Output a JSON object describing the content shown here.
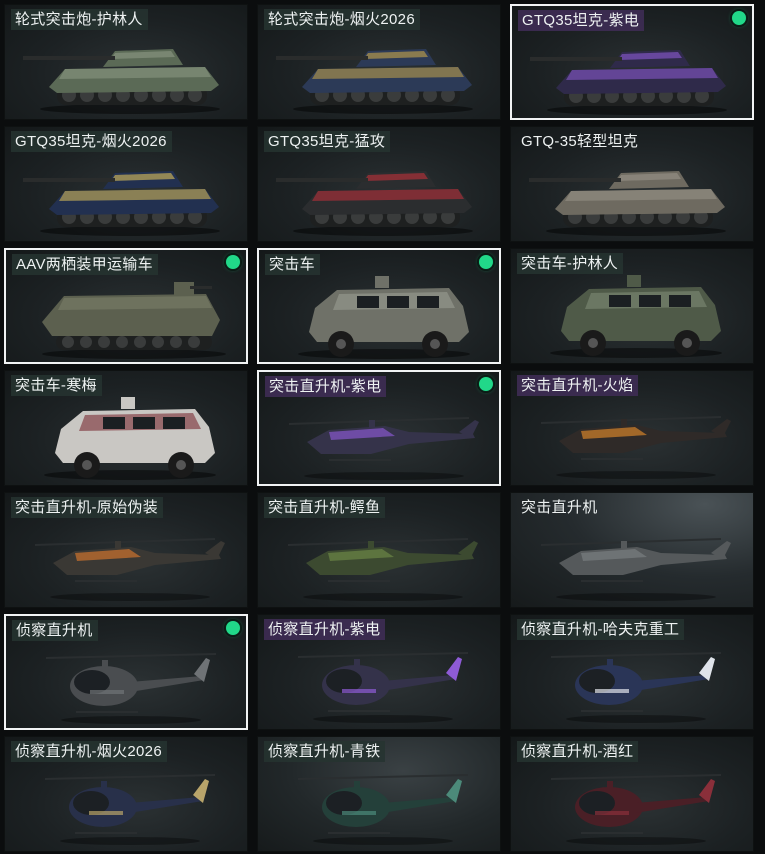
{
  "vehicles": [
    {
      "name": "轮式突击炮-护林人",
      "type": "tank",
      "body": "#5b6a56",
      "accent": "#8e9a86",
      "equipped": false
    },
    {
      "name": "轮式突击炮-烟火2026",
      "type": "tank",
      "body": "#2c3a57",
      "accent": "#c9a64a",
      "equipped": false
    },
    {
      "name": "GTQ35坦克-紫电",
      "type": "tank",
      "body": "#2f2a4a",
      "accent": "#8e5bd6",
      "equipped": true
    },
    {
      "name": "GTQ35坦克-烟火2026",
      "type": "tank",
      "body": "#223050",
      "accent": "#e0c25a",
      "equipped": false
    },
    {
      "name": "GTQ35坦克-猛攻",
      "type": "tank",
      "body": "#2b2d2f",
      "accent": "#c2303a",
      "equipped": false
    },
    {
      "name": "GTQ-35轻型坦克",
      "type": "tank",
      "body": "#6e6a60",
      "accent": "#9a958a",
      "equipped": false
    },
    {
      "name": "AAV两栖装甲运输车",
      "type": "apc",
      "body": "#5c604f",
      "accent": "#7d826c",
      "equipped": true
    },
    {
      "name": "突击车",
      "type": "car",
      "body": "#6f7168",
      "accent": "#9a9c92",
      "equipped": true
    },
    {
      "name": "突击车-护林人",
      "type": "car",
      "body": "#4f5a48",
      "accent": "#7f8a76",
      "equipped": false
    },
    {
      "name": "突击车-寒梅",
      "type": "car",
      "body": "#c9c7c3",
      "accent": "#7a2b33",
      "equipped": false
    },
    {
      "name": "突击直升机-紫电",
      "type": "heli",
      "body": "#35334a",
      "accent": "#8e5bd6",
      "equipped": true
    },
    {
      "name": "突击直升机-火焰",
      "type": "heli",
      "body": "#2f2a28",
      "accent": "#e08a2a",
      "equipped": false
    },
    {
      "name": "突击直升机-原始伪装",
      "type": "heli",
      "body": "#3a3834",
      "accent": "#d8782c",
      "equipped": false
    },
    {
      "name": "突击直升机-鳄鱼",
      "type": "heli",
      "body": "#3c4a30",
      "accent": "#6f8a48",
      "equipped": false
    },
    {
      "name": "突击直升机",
      "type": "heli",
      "body": "#55595b",
      "accent": "#7c8184",
      "equipped": false
    },
    {
      "name": "侦察直升机",
      "type": "scout",
      "body": "#4a4d50",
      "accent": "#6f7376",
      "equipped": true
    },
    {
      "name": "侦察直升机-紫电",
      "type": "scout",
      "body": "#34324a",
      "accent": "#8e5bd6",
      "equipped": false
    },
    {
      "name": "侦察直升机-哈夫克重工",
      "type": "scout",
      "body": "#2a3557",
      "accent": "#dfe3ea",
      "equipped": false
    },
    {
      "name": "侦察直升机-烟火2026",
      "type": "scout",
      "body": "#28304a",
      "accent": "#b8a46a",
      "equipped": false
    },
    {
      "name": "侦察直升机-青铁",
      "type": "scout",
      "body": "#24403a",
      "accent": "#4c8a7a",
      "equipped": false
    },
    {
      "name": "侦察直升机-酒红",
      "type": "scout",
      "body": "#4a1f26",
      "accent": "#8a2f3a",
      "equipped": false
    }
  ]
}
